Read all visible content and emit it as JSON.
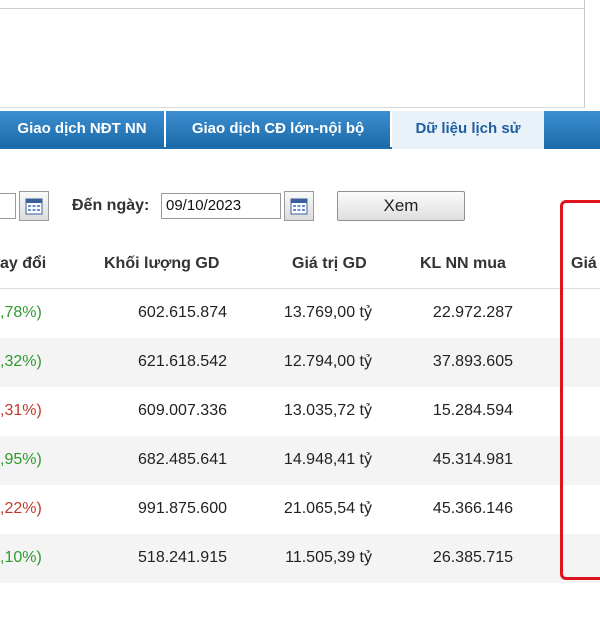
{
  "tabs": [
    {
      "label": "Giao dịch NĐT NN",
      "active": false
    },
    {
      "label": "Giao dịch CĐ lớn-nội bộ",
      "active": false
    },
    {
      "label": "Dữ liệu lịch sử",
      "active": true
    }
  ],
  "filter": {
    "to_label": "Đến ngày:",
    "to_value": "09/10/2023",
    "view_button": "Xem"
  },
  "table": {
    "headers": [
      "ay đổi",
      "Khối lượng GD",
      "Giá trị GD",
      "KL NN mua",
      "Giá"
    ],
    "rows": [
      {
        "change": ",78%)",
        "direction": "up",
        "volume": "602.615.874",
        "value": "13.769,00 tỷ",
        "foreign_buy": "22.972.287"
      },
      {
        "change": ",32%)",
        "direction": "up",
        "volume": "621.618.542",
        "value": "12.794,00 tỷ",
        "foreign_buy": "37.893.605"
      },
      {
        "change": ",31%)",
        "direction": "down",
        "volume": "609.007.336",
        "value": "13.035,72 tỷ",
        "foreign_buy": "15.284.594"
      },
      {
        "change": ",95%)",
        "direction": "up",
        "volume": "682.485.641",
        "value": "14.948,41 tỷ",
        "foreign_buy": "45.314.981"
      },
      {
        "change": ",22%)",
        "direction": "down",
        "volume": "991.875.600",
        "value": "21.065,54 tỷ",
        "foreign_buy": "45.366.146"
      },
      {
        "change": ",10%)",
        "direction": "up",
        "volume": "518.241.915",
        "value": "11.505,39 tỷ",
        "foreign_buy": "26.385.715"
      }
    ]
  },
  "colors": {
    "up": "#2e9a2e",
    "down": "#c0392b",
    "tab_blue": "#1e6fb0",
    "highlight": "#e0141c"
  },
  "icons": {
    "calendar": "calendar-icon"
  }
}
